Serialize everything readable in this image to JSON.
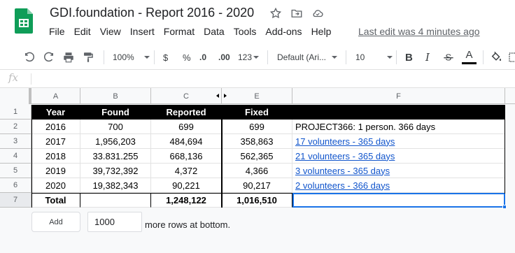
{
  "document": {
    "title": "GDI.foundation - Report 2016 - 2020",
    "last_edit": "Last edit was 4 minutes ago"
  },
  "menu": [
    "File",
    "Edit",
    "View",
    "Insert",
    "Format",
    "Data",
    "Tools",
    "Add-ons",
    "Help"
  ],
  "toolbar": {
    "zoom": "100%",
    "currency": "$",
    "percent": "%",
    "decrease_decimals": ".0",
    "increase_decimals": ".00",
    "more_formats": "123",
    "font": "Default (Ari...",
    "font_size": "10",
    "bold": "B",
    "italic": "I",
    "text_color": "A"
  },
  "formula_bar": {
    "fx": "fx",
    "value": ""
  },
  "columns": [
    "A",
    "B",
    "C",
    "E",
    "F"
  ],
  "row_numbers": [
    "1",
    "2",
    "3",
    "4",
    "5",
    "6",
    "7"
  ],
  "table": {
    "headers": [
      "Year",
      "Found",
      "Reported",
      "Fixed",
      ""
    ],
    "rows": [
      {
        "year": "2016",
        "found": "700",
        "reported": "699",
        "fixed": "699",
        "note": "PROJECT366: 1 person. 366 days",
        "note_is_link": false
      },
      {
        "year": "2017",
        "found": "1,956,203",
        "reported": "484,694",
        "fixed": "358,863",
        "note": "17 volunteers - 365 days",
        "note_is_link": true
      },
      {
        "year": "2018",
        "found": "33.831.255",
        "reported": "668,136",
        "fixed": "562,365",
        "note": "21 volunteers - 365 days",
        "note_is_link": true
      },
      {
        "year": "2019",
        "found": "39,732,392",
        "reported": "4,372",
        "fixed": "4,366",
        "note": "3 volunteers - 365 days",
        "note_is_link": true
      },
      {
        "year": "2020",
        "found": "19,382,343",
        "reported": "90,221",
        "fixed": "90,217",
        "note": "2 volunteers - 366 days",
        "note_is_link": true
      }
    ],
    "total": {
      "label": "Total",
      "found": "",
      "reported": "1,248,122",
      "fixed": "1,016,510",
      "note": ""
    }
  },
  "add_rows": {
    "button_label": "Add",
    "count": "1000",
    "suffix": "more rows at bottom."
  },
  "colors": {
    "sheets_green": "#0f9d58",
    "header_black": "#000000",
    "link_blue": "#1155cc",
    "selection_blue": "#1a73e8"
  }
}
